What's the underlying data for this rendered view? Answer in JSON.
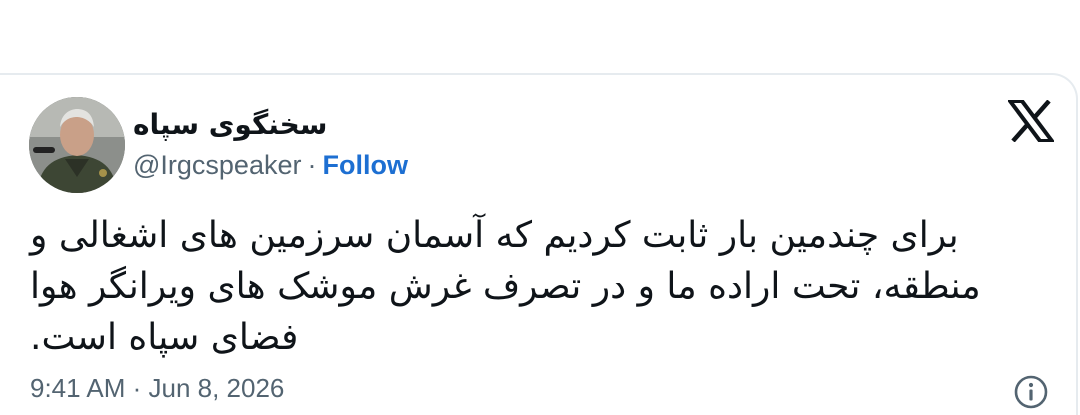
{
  "post": {
    "author": {
      "display_name": "سخنگوی سپاه",
      "handle": "@Irgcspeaker",
      "separator": "·",
      "follow_label": "Follow"
    },
    "text_lines": [
      "برای چندمین بار ثابت کردیم که آسمان سرزمین های اشغالی و",
      "منطقه، تحت اراده ما و در تصرف غرش موشک های ویرانگر هوا",
      "فضای سپاه است."
    ],
    "timestamp": "9:41 AM · Jun 8, 2026"
  },
  "icons": {
    "brand": "x-logo-icon",
    "info": "info-icon",
    "avatar": "avatar-photo"
  },
  "colors": {
    "link": "#1d6fd2",
    "muted": "#536471",
    "text": "#0f1419",
    "border": "#e6ebef"
  }
}
